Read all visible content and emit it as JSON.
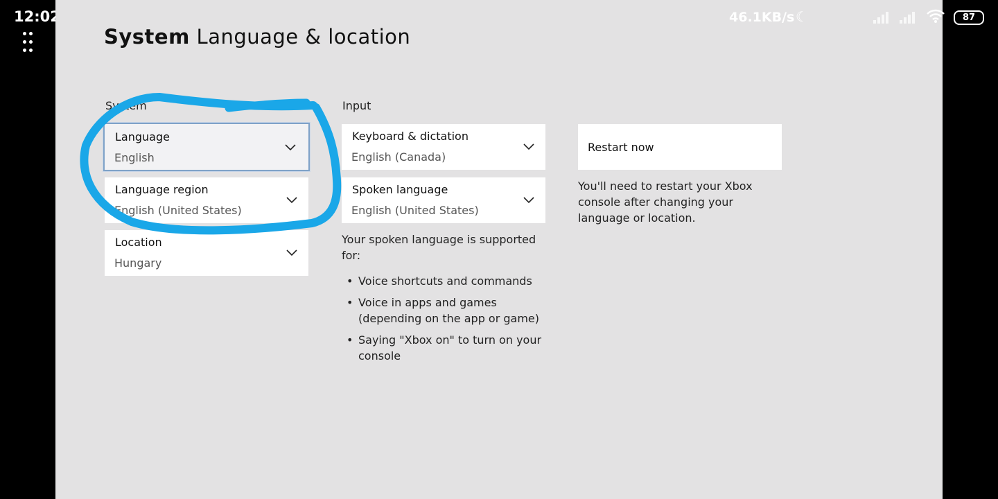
{
  "status_bar": {
    "time": "12:02",
    "network_speed": "46.1KB/s",
    "battery": "87"
  },
  "header": {
    "title_strong": "System",
    "title_rest": "Language & location"
  },
  "system_section": {
    "label": "System",
    "language": {
      "label": "Language",
      "value": "English"
    },
    "language_region": {
      "label": "Language region",
      "value": "English (United States)"
    },
    "location": {
      "label": "Location",
      "value": "Hungary"
    }
  },
  "input_section": {
    "label": "Input",
    "keyboard": {
      "label": "Keyboard & dictation",
      "value": "English (Canada)"
    },
    "spoken": {
      "label": "Spoken language",
      "value": "English (United States)"
    },
    "support_note": "Your spoken language is supported for:",
    "bullets": [
      "Voice shortcuts and commands",
      "Voice in apps and games (depending on the app or game)",
      "Saying \"Xbox on\" to turn on your console"
    ]
  },
  "restart": {
    "button_label": "Restart now",
    "note": "You'll need to restart your Xbox console after changing your language or location."
  },
  "colors": {
    "background": "#e3e2e3",
    "annotation": "#1aa7e8",
    "focus_border": "#7fa2c8"
  }
}
